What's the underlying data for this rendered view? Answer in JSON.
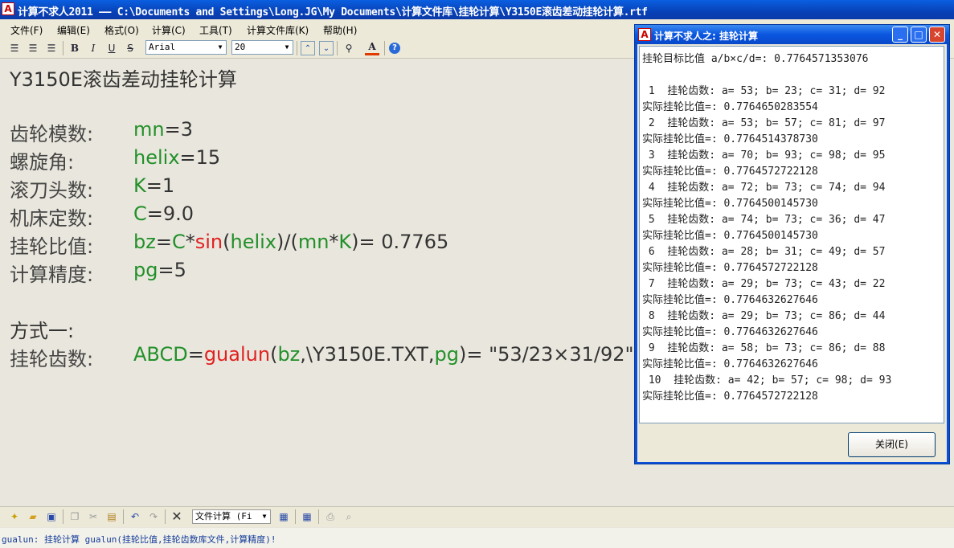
{
  "window": {
    "title": "计算不求人2011 —— C:\\Documents and Settings\\Long.JG\\My Documents\\计算文件库\\挂轮计算\\Y3150E滚齿差动挂轮计算.rtf"
  },
  "menu": [
    "文件(F)",
    "编辑(E)",
    "格式(O)",
    "计算(C)",
    "工具(T)",
    "计算文件库(K)",
    "帮助(H)"
  ],
  "toolbar": {
    "font_name": "Arial",
    "font_size": "20",
    "font_color": "#e03a00"
  },
  "document": {
    "heading": "Y3150E滚齿差动挂轮计算",
    "rows": [
      {
        "label": "齿轮模数:",
        "parts": [
          "mn",
          "=3"
        ]
      },
      {
        "label": "螺旋角:",
        "parts": [
          "helix",
          "=15"
        ]
      },
      {
        "label": "滚刀头数:",
        "parts": [
          "K",
          "=1"
        ]
      },
      {
        "label": "机床定数:",
        "parts": [
          "C",
          "=9.0"
        ]
      }
    ],
    "ratio_label": "挂轮比值:",
    "ratio": {
      "a": "bz",
      "b": "=",
      "c": "C",
      "d": "*",
      "e": "sin",
      "f": "(",
      "g": "helix",
      "h": ")/(",
      "i": "mn",
      "j": "*",
      "k": "K",
      "l": ")= 0.7765"
    },
    "precision_label": "计算精度:",
    "precision": {
      "a": "pg",
      "b": "=5"
    },
    "method_label": "方式一:",
    "gear_label": "挂轮齿数:",
    "gear": {
      "a": "ABCD",
      "b": "=",
      "c": "gualun",
      "d": "(",
      "e": "bz",
      "f": ",\\Y3150E.TXT,",
      "g": "pg",
      "h": ")= \"53/23×31/92\""
    }
  },
  "bottom_toolbar": {
    "combo_label": "文件计算 (Fi"
  },
  "status": {
    "text": "gualun: 挂轮计算 gualun(挂轮比值,挂轮齿数库文件,计算精度)!"
  },
  "dialog": {
    "title": "计算不求人之: 挂轮计算",
    "target_line": "挂轮目标比值 a/b×c/d=: 0.7764571353076",
    "results": [
      {
        "gears": " 1  挂轮齿数: a= 53; b= 23; c= 31; d= 92",
        "actual": "实际挂轮比值=: 0.7764650283554"
      },
      {
        "gears": " 2  挂轮齿数: a= 53; b= 57; c= 81; d= 97",
        "actual": "实际挂轮比值=: 0.7764514378730"
      },
      {
        "gears": " 3  挂轮齿数: a= 70; b= 93; c= 98; d= 95",
        "actual": "实际挂轮比值=: 0.7764572722128"
      },
      {
        "gears": " 4  挂轮齿数: a= 72; b= 73; c= 74; d= 94",
        "actual": "实际挂轮比值=: 0.7764500145730"
      },
      {
        "gears": " 5  挂轮齿数: a= 74; b= 73; c= 36; d= 47",
        "actual": "实际挂轮比值=: 0.7764500145730"
      },
      {
        "gears": " 6  挂轮齿数: a= 28; b= 31; c= 49; d= 57",
        "actual": "实际挂轮比值=: 0.7764572722128"
      },
      {
        "gears": " 7  挂轮齿数: a= 29; b= 73; c= 43; d= 22",
        "actual": "实际挂轮比值=: 0.7764632627646"
      },
      {
        "gears": " 8  挂轮齿数: a= 29; b= 73; c= 86; d= 44",
        "actual": "实际挂轮比值=: 0.7764632627646"
      },
      {
        "gears": " 9  挂轮齿数: a= 58; b= 73; c= 86; d= 88",
        "actual": "实际挂轮比值=: 0.7764632627646"
      },
      {
        "gears": " 10  挂轮齿数: a= 42; b= 57; c= 98; d= 93",
        "actual": "实际挂轮比值=: 0.7764572722128"
      }
    ],
    "close_label": "关闭(E)"
  }
}
